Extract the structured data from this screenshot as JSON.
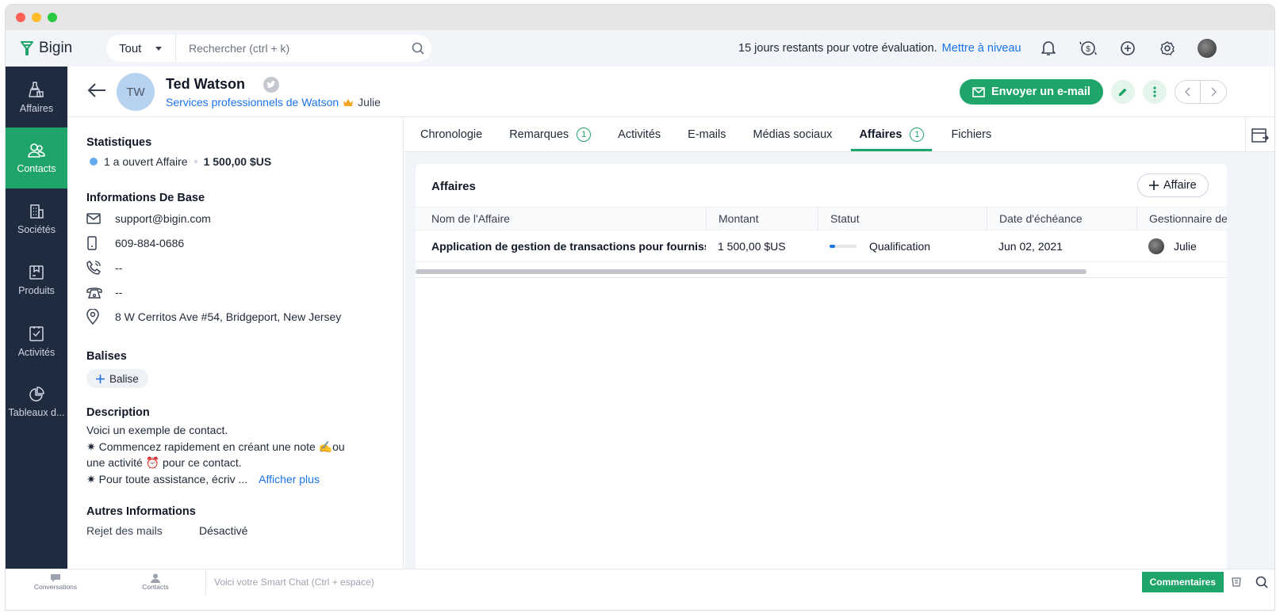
{
  "window": {
    "traffic_lights": [
      "#fe5f57",
      "#febc2e",
      "#28c840"
    ]
  },
  "topbar": {
    "brand": "Bigin",
    "search_scope": "Tout",
    "search_placeholder": "Rechercher (ctrl + k)",
    "trial_text": "15 jours restants pour votre évaluation.",
    "upgrade_link": "Mettre à niveau"
  },
  "sidebar": {
    "items": [
      {
        "label": "Affaires",
        "icon": "deals-icon"
      },
      {
        "label": "Contacts",
        "icon": "contacts-icon",
        "active": true
      },
      {
        "label": "Sociétés",
        "icon": "companies-icon"
      },
      {
        "label": "Produits",
        "icon": "products-icon"
      },
      {
        "label": "Activités",
        "icon": "activities-icon"
      },
      {
        "label": "Tableaux d...",
        "icon": "dashboards-icon"
      }
    ]
  },
  "contact": {
    "initials": "TW",
    "name": "Ted Watson",
    "company": "Services professionnels de Watson",
    "owner": "Julie",
    "send_email": "Envoyer un e-mail"
  },
  "details": {
    "stats_title": "Statistiques",
    "stats_open": "1 a ouvert Affaire",
    "stats_amount": "1 500,00 $US",
    "basic_title": "Informations De Base",
    "email": "support@bigin.com",
    "mobile": "609-884-0686",
    "phone": "--",
    "other_phone": "--",
    "address": "8 W Cerritos Ave #54, Bridgeport, New Jersey",
    "tags_title": "Balises",
    "tag_button": "Balise",
    "desc_title": "Description",
    "desc_line1": "Voici un exemple de contact.",
    "desc_line2": "✷ Commencez rapidement en créant une note ✍ou",
    "desc_line3": "une activité ⏰ pour ce contact.",
    "desc_line4": "✷ Pour toute assistance, écriv ...",
    "show_more": "Afficher plus",
    "other_title": "Autres Informations",
    "opt_out_label": "Rejet des mails",
    "opt_out_value": "Désactivé"
  },
  "tabs": [
    {
      "label": "Chronologie"
    },
    {
      "label": "Remarques",
      "count": "1"
    },
    {
      "label": "Activités"
    },
    {
      "label": "E-mails"
    },
    {
      "label": "Médias sociaux"
    },
    {
      "label": "Affaires",
      "count": "1",
      "active": true
    },
    {
      "label": "Fichiers"
    }
  ],
  "deals": {
    "title": "Affaires",
    "add_button": "Affaire",
    "columns": [
      "Nom de l'Affaire",
      "Montant",
      "Statut",
      "Date d'échéance",
      "Gestionnaire de"
    ],
    "rows": [
      {
        "name": "Application de gestion de transactions pour fournisseurs",
        "amount": "1 500,00 $US",
        "stage": "Qualification",
        "stage_progress": 0.2,
        "due": "Jun 02, 2021",
        "owner": "Julie"
      }
    ]
  },
  "bottombar": {
    "conversations": "Conversations",
    "contacts": "Contacts",
    "smart_chat": "Voici votre Smart Chat (Ctrl + espace)",
    "comments": "Commentaires"
  }
}
